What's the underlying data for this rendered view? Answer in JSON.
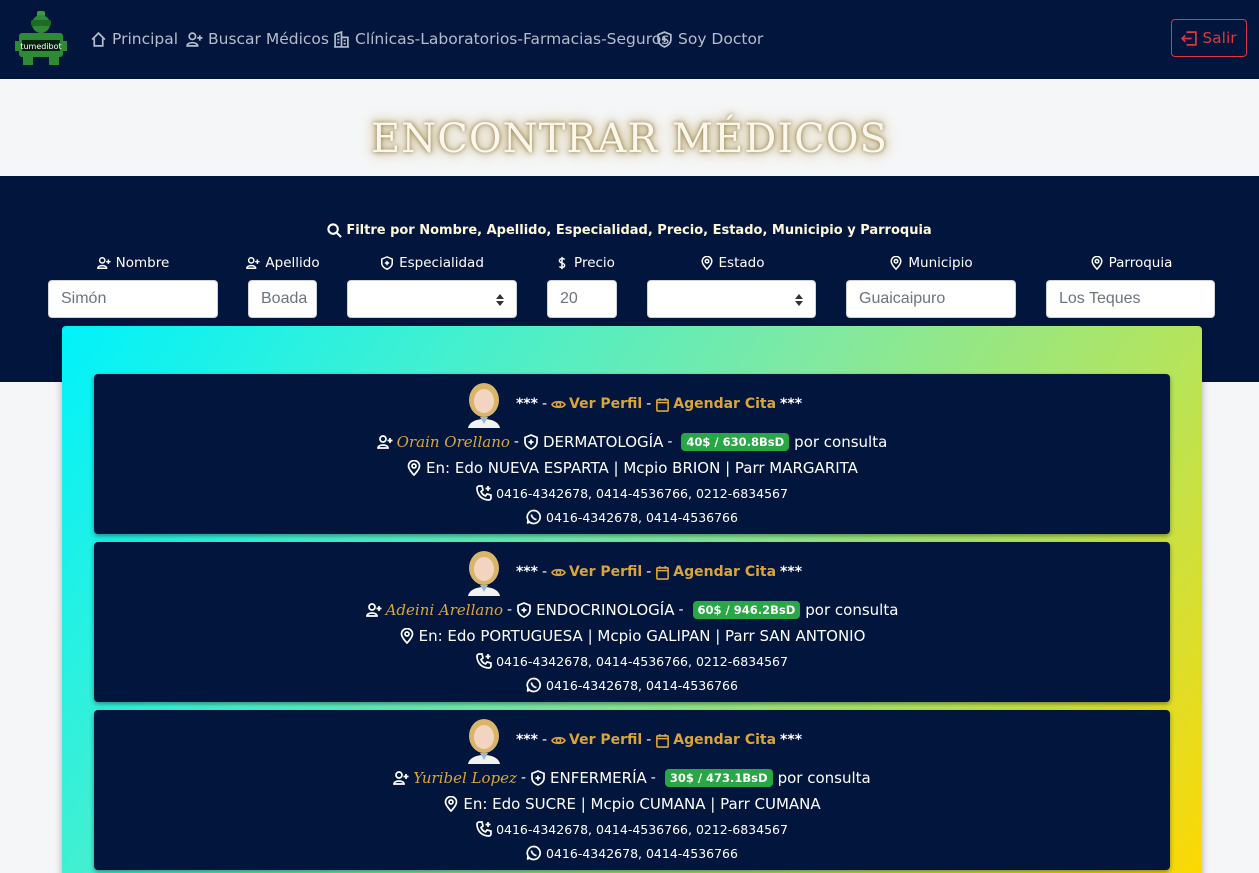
{
  "nav": {
    "logo_text": "tumedibot",
    "items": [
      {
        "label": "Principal"
      },
      {
        "label": "Buscar Médicos"
      },
      {
        "label": "Clínicas-Laboratorios-Farmacias-Seguros"
      },
      {
        "label": "Soy Doctor"
      }
    ],
    "logout_label": "Salir"
  },
  "page_title": "ENCONTRAR MÉDICOS",
  "filter": {
    "title": "Filtre por Nombre, Apellido, Especialidad, Precio, Estado, Municipio y Parroquia",
    "fields": [
      {
        "label": "Nombre",
        "value": "Simón"
      },
      {
        "label": "Apellido",
        "value": "Boada"
      },
      {
        "label": "Especialidad",
        "value": ""
      },
      {
        "label": "Precio",
        "value": "20"
      },
      {
        "label": "Estado",
        "value": ""
      },
      {
        "label": "Municipio",
        "value": "Guaicaipuro"
      },
      {
        "label": "Parroquia",
        "value": "Los Teques"
      }
    ]
  },
  "results": {
    "stars_left": "***",
    "stars_right": "***",
    "view_profile_label": "Ver Perfil",
    "schedule_label": "Agendar Cita",
    "dash": "-",
    "per_consult": "por consulta",
    "doctors": [
      {
        "name": "Orain Orellano",
        "specialty": "DERMATOLOGÍA",
        "price": "40$ / 630.8BsD",
        "location": "En: Edo NUEVA ESPARTA | Mcpio BRION | Parr MARGARITA",
        "phones": "0416-4342678, 0414-4536766, 0212-6834567",
        "whatsapp": "0416-4342678, 0414-4536766"
      },
      {
        "name": "Adeini Arellano",
        "specialty": "ENDOCRINOLOGÍA",
        "price": "60$ / 946.2BsD",
        "location": "En: Edo PORTUGUESA | Mcpio GALIPAN | Parr SAN ANTONIO",
        "phones": "0416-4342678, 0414-4536766, 0212-6834567",
        "whatsapp": "0416-4342678, 0414-4536766"
      },
      {
        "name": "Yuribel Lopez",
        "specialty": "ENFERMERÍA",
        "price": "30$ / 473.1BsD",
        "location": "En: Edo SUCRE | Mcpio CUMANA | Parr CUMANA",
        "phones": "0416-4342678, 0414-4536766, 0212-6834567",
        "whatsapp": "0416-4342678, 0414-4536766"
      }
    ]
  },
  "colors": {
    "navy": "#02163d",
    "gold": "#d9a53a",
    "price_green": "#28a745",
    "logout_red": "#dc3545"
  }
}
